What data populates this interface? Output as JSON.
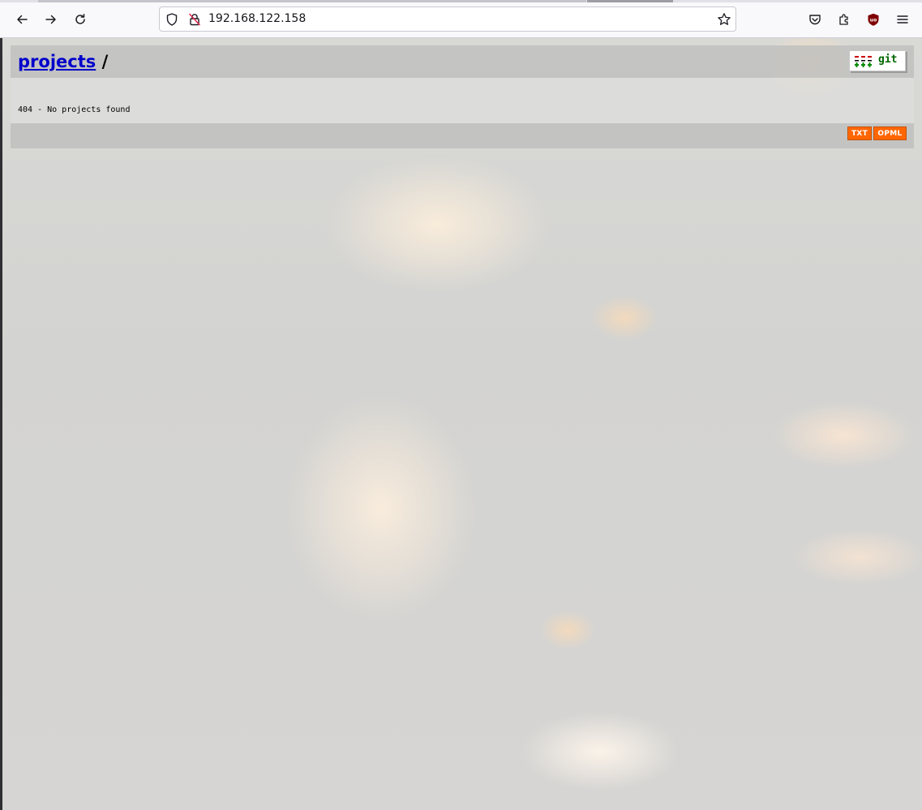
{
  "browser": {
    "url": "192.168.122.158",
    "icons": [
      "back-icon",
      "forward-icon",
      "reload-icon",
      "shield-icon",
      "insecure-lock-icon",
      "bookmark-star-icon",
      "pocket-icon",
      "extensions-icon",
      "ublock-icon",
      "menu-icon"
    ]
  },
  "page": {
    "breadcrumb_link": "projects",
    "breadcrumb_sep": "/",
    "logo_text": "git",
    "message": "404 - No projects found",
    "footer": {
      "txt_label": "TXT",
      "opml_label": "OPML"
    }
  },
  "colors": {
    "header_bg": "#c0c0be",
    "link": "#0000cc",
    "feed_button": "#ff6600"
  }
}
